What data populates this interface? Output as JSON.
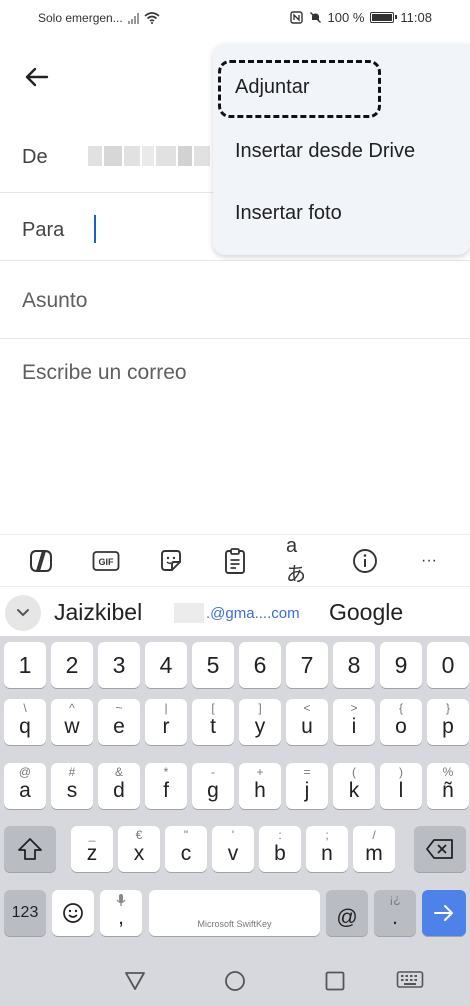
{
  "status_bar": {
    "carrier": "Solo emergen...",
    "battery": "100 %",
    "time": "11:08"
  },
  "compose": {
    "from_label": "De",
    "to_label": "Para",
    "subject_placeholder": "Asunto",
    "body_placeholder": "Escribe un correo"
  },
  "attach_menu": {
    "items": [
      "Adjuntar",
      "Insertar desde Drive",
      "Insertar foto"
    ]
  },
  "keyboard_toolbar": {
    "gif_label": "GIF",
    "translate_label": "aあ",
    "more_label": "···"
  },
  "suggestions": {
    "word1": "Jaizkibel",
    "email_suffix": ".@gma....com",
    "word2": "Google"
  },
  "keyboard": {
    "numbers": [
      "1",
      "2",
      "3",
      "4",
      "5",
      "6",
      "7",
      "8",
      "9",
      "0"
    ],
    "row1": [
      {
        "k": "q",
        "s": "\\"
      },
      {
        "k": "w",
        "s": "^"
      },
      {
        "k": "e",
        "s": "~"
      },
      {
        "k": "r",
        "s": "|"
      },
      {
        "k": "t",
        "s": "["
      },
      {
        "k": "y",
        "s": "]"
      },
      {
        "k": "u",
        "s": "<"
      },
      {
        "k": "i",
        "s": ">"
      },
      {
        "k": "o",
        "s": "{"
      },
      {
        "k": "p",
        "s": "}"
      }
    ],
    "row2": [
      {
        "k": "a",
        "s": "@"
      },
      {
        "k": "s",
        "s": "#"
      },
      {
        "k": "d",
        "s": "&"
      },
      {
        "k": "f",
        "s": "*"
      },
      {
        "k": "g",
        "s": "-"
      },
      {
        "k": "h",
        "s": "+"
      },
      {
        "k": "j",
        "s": "="
      },
      {
        "k": "k",
        "s": "("
      },
      {
        "k": "l",
        "s": ")"
      },
      {
        "k": "ñ",
        "s": "%"
      }
    ],
    "row3": [
      {
        "k": "z",
        "s": "_"
      },
      {
        "k": "x",
        "s": "€"
      },
      {
        "k": "c",
        "s": "\""
      },
      {
        "k": "v",
        "s": "'"
      },
      {
        "k": "b",
        "s": ":"
      },
      {
        "k": "n",
        "s": ";"
      },
      {
        "k": "m",
        "s": "/"
      }
    ],
    "symbols_key": "123",
    "comma_key": ",",
    "space_label": "Microsoft SwiftKey",
    "at_key": "@",
    "period_key": ".",
    "period_sec": "¡¿"
  }
}
